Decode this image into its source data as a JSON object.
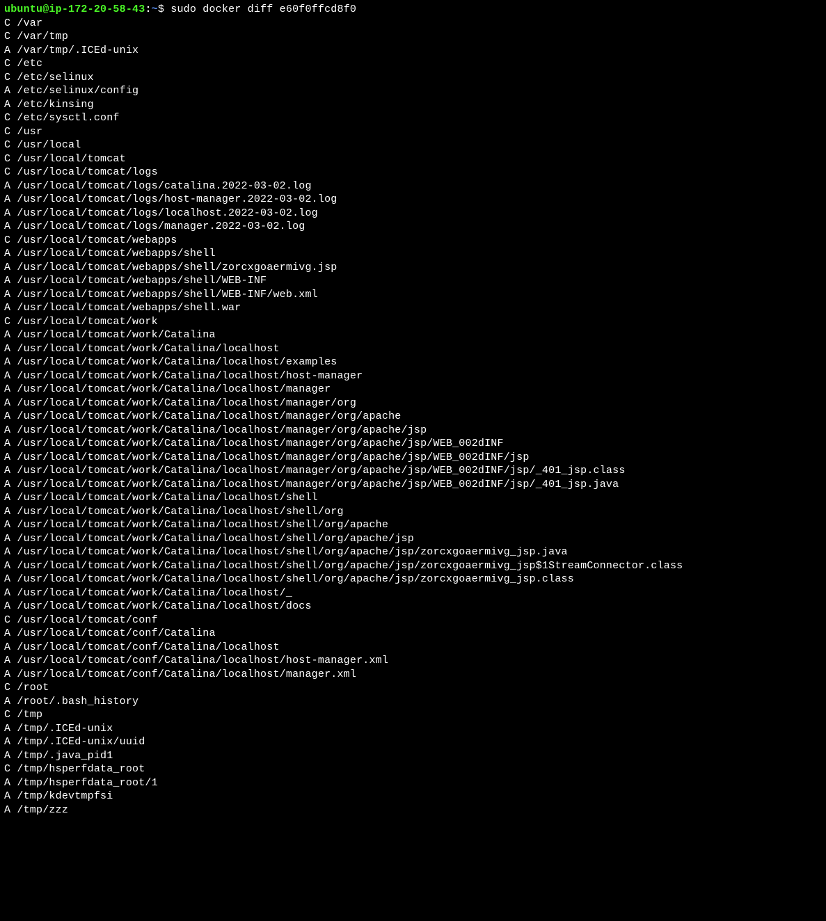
{
  "prompt": {
    "user_host": "ubuntu@ip-172-20-58-43",
    "colon": ":",
    "path": "~",
    "dollar": "$",
    "command": "sudo docker diff e60f0ffcd8f0"
  },
  "diff_output": [
    {
      "flag": "C",
      "path": "/var"
    },
    {
      "flag": "C",
      "path": "/var/tmp"
    },
    {
      "flag": "A",
      "path": "/var/tmp/.ICEd-unix"
    },
    {
      "flag": "C",
      "path": "/etc"
    },
    {
      "flag": "C",
      "path": "/etc/selinux"
    },
    {
      "flag": "A",
      "path": "/etc/selinux/config"
    },
    {
      "flag": "A",
      "path": "/etc/kinsing"
    },
    {
      "flag": "C",
      "path": "/etc/sysctl.conf"
    },
    {
      "flag": "C",
      "path": "/usr"
    },
    {
      "flag": "C",
      "path": "/usr/local"
    },
    {
      "flag": "C",
      "path": "/usr/local/tomcat"
    },
    {
      "flag": "C",
      "path": "/usr/local/tomcat/logs"
    },
    {
      "flag": "A",
      "path": "/usr/local/tomcat/logs/catalina.2022-03-02.log"
    },
    {
      "flag": "A",
      "path": "/usr/local/tomcat/logs/host-manager.2022-03-02.log"
    },
    {
      "flag": "A",
      "path": "/usr/local/tomcat/logs/localhost.2022-03-02.log"
    },
    {
      "flag": "A",
      "path": "/usr/local/tomcat/logs/manager.2022-03-02.log"
    },
    {
      "flag": "C",
      "path": "/usr/local/tomcat/webapps"
    },
    {
      "flag": "A",
      "path": "/usr/local/tomcat/webapps/shell"
    },
    {
      "flag": "A",
      "path": "/usr/local/tomcat/webapps/shell/zorcxgoaermivg.jsp"
    },
    {
      "flag": "A",
      "path": "/usr/local/tomcat/webapps/shell/WEB-INF"
    },
    {
      "flag": "A",
      "path": "/usr/local/tomcat/webapps/shell/WEB-INF/web.xml"
    },
    {
      "flag": "A",
      "path": "/usr/local/tomcat/webapps/shell.war"
    },
    {
      "flag": "C",
      "path": "/usr/local/tomcat/work"
    },
    {
      "flag": "A",
      "path": "/usr/local/tomcat/work/Catalina"
    },
    {
      "flag": "A",
      "path": "/usr/local/tomcat/work/Catalina/localhost"
    },
    {
      "flag": "A",
      "path": "/usr/local/tomcat/work/Catalina/localhost/examples"
    },
    {
      "flag": "A",
      "path": "/usr/local/tomcat/work/Catalina/localhost/host-manager"
    },
    {
      "flag": "A",
      "path": "/usr/local/tomcat/work/Catalina/localhost/manager"
    },
    {
      "flag": "A",
      "path": "/usr/local/tomcat/work/Catalina/localhost/manager/org"
    },
    {
      "flag": "A",
      "path": "/usr/local/tomcat/work/Catalina/localhost/manager/org/apache"
    },
    {
      "flag": "A",
      "path": "/usr/local/tomcat/work/Catalina/localhost/manager/org/apache/jsp"
    },
    {
      "flag": "A",
      "path": "/usr/local/tomcat/work/Catalina/localhost/manager/org/apache/jsp/WEB_002dINF"
    },
    {
      "flag": "A",
      "path": "/usr/local/tomcat/work/Catalina/localhost/manager/org/apache/jsp/WEB_002dINF/jsp"
    },
    {
      "flag": "A",
      "path": "/usr/local/tomcat/work/Catalina/localhost/manager/org/apache/jsp/WEB_002dINF/jsp/_401_jsp.class"
    },
    {
      "flag": "A",
      "path": "/usr/local/tomcat/work/Catalina/localhost/manager/org/apache/jsp/WEB_002dINF/jsp/_401_jsp.java"
    },
    {
      "flag": "A",
      "path": "/usr/local/tomcat/work/Catalina/localhost/shell"
    },
    {
      "flag": "A",
      "path": "/usr/local/tomcat/work/Catalina/localhost/shell/org"
    },
    {
      "flag": "A",
      "path": "/usr/local/tomcat/work/Catalina/localhost/shell/org/apache"
    },
    {
      "flag": "A",
      "path": "/usr/local/tomcat/work/Catalina/localhost/shell/org/apache/jsp"
    },
    {
      "flag": "A",
      "path": "/usr/local/tomcat/work/Catalina/localhost/shell/org/apache/jsp/zorcxgoaermivg_jsp.java"
    },
    {
      "flag": "A",
      "path": "/usr/local/tomcat/work/Catalina/localhost/shell/org/apache/jsp/zorcxgoaermivg_jsp$1StreamConnector.class"
    },
    {
      "flag": "A",
      "path": "/usr/local/tomcat/work/Catalina/localhost/shell/org/apache/jsp/zorcxgoaermivg_jsp.class"
    },
    {
      "flag": "A",
      "path": "/usr/local/tomcat/work/Catalina/localhost/_"
    },
    {
      "flag": "A",
      "path": "/usr/local/tomcat/work/Catalina/localhost/docs"
    },
    {
      "flag": "C",
      "path": "/usr/local/tomcat/conf"
    },
    {
      "flag": "A",
      "path": "/usr/local/tomcat/conf/Catalina"
    },
    {
      "flag": "A",
      "path": "/usr/local/tomcat/conf/Catalina/localhost"
    },
    {
      "flag": "A",
      "path": "/usr/local/tomcat/conf/Catalina/localhost/host-manager.xml"
    },
    {
      "flag": "A",
      "path": "/usr/local/tomcat/conf/Catalina/localhost/manager.xml"
    },
    {
      "flag": "C",
      "path": "/root"
    },
    {
      "flag": "A",
      "path": "/root/.bash_history"
    },
    {
      "flag": "C",
      "path": "/tmp"
    },
    {
      "flag": "A",
      "path": "/tmp/.ICEd-unix"
    },
    {
      "flag": "A",
      "path": "/tmp/.ICEd-unix/uuid"
    },
    {
      "flag": "A",
      "path": "/tmp/.java_pid1"
    },
    {
      "flag": "C",
      "path": "/tmp/hsperfdata_root"
    },
    {
      "flag": "A",
      "path": "/tmp/hsperfdata_root/1"
    },
    {
      "flag": "A",
      "path": "/tmp/kdevtmpfsi"
    },
    {
      "flag": "A",
      "path": "/tmp/zzz"
    }
  ]
}
